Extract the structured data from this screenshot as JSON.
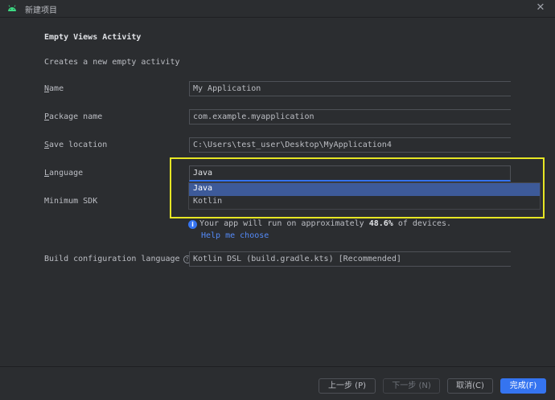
{
  "window": {
    "title": "新建项目"
  },
  "form": {
    "heading": "Empty Views Activity",
    "description": "Creates a new empty activity",
    "name": {
      "label_first": "N",
      "label_rest": "ame",
      "value": "My Application"
    },
    "package": {
      "label_first": "P",
      "label_rest": "ackage name",
      "value": "com.example.myapplication"
    },
    "save_location": {
      "label_first": "S",
      "label_rest": "ave location",
      "value": "C:\\Users\\test_user\\Desktop\\MyApplication4"
    },
    "language": {
      "label_first": "L",
      "label_rest": "anguage",
      "value": "Java",
      "options": [
        "Java",
        "Kotlin"
      ],
      "selected_index": 0
    },
    "minimum_sdk": {
      "label": "Minimum SDK"
    },
    "info": {
      "prefix": "Your app will run on approximately ",
      "percent": "48.6%",
      "suffix": " of devices.",
      "link": "Help me choose"
    },
    "build_config": {
      "label": "Build configuration language",
      "value": "Kotlin DSL (build.gradle.kts) [Recommended]"
    }
  },
  "buttons": {
    "previous": "上一步 (P)",
    "next": "下一步 (N)",
    "cancel": "取消(C)",
    "finish": "完成(F)"
  },
  "colors": {
    "accent": "#3574f0",
    "highlight_box": "#e6e624",
    "link": "#548af7",
    "background": "#2b2d30"
  },
  "icons": {
    "app": "android-icon",
    "close": "close-icon",
    "info": "info-icon",
    "help": "question-icon"
  }
}
